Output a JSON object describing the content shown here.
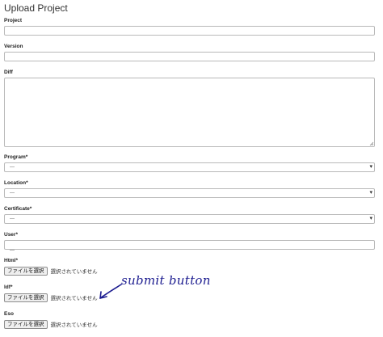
{
  "title": "Upload Project",
  "fields": {
    "project_label": "Project",
    "version_label": "Version",
    "diff_label": "Diff",
    "program_label": "Program*",
    "program_value": "---",
    "location_label": "Location*",
    "location_value": "---",
    "certificate_label": "Certificate*",
    "certificate_value": "---",
    "user_label": "User*",
    "user_value": "---",
    "html_label": "Html*",
    "ldf_label": "ldf*",
    "eso_label": "Eso"
  },
  "file_input": {
    "button_label": "ファイルを選択",
    "status_text": "選択されていません"
  },
  "annotation": {
    "text": "submit button",
    "color": "#1b1b8f"
  },
  "icons": {
    "select_caret": "caret-down-icon",
    "resize_handle": "resize-handle-icon",
    "annotation_arrow": "arrow-icon"
  }
}
